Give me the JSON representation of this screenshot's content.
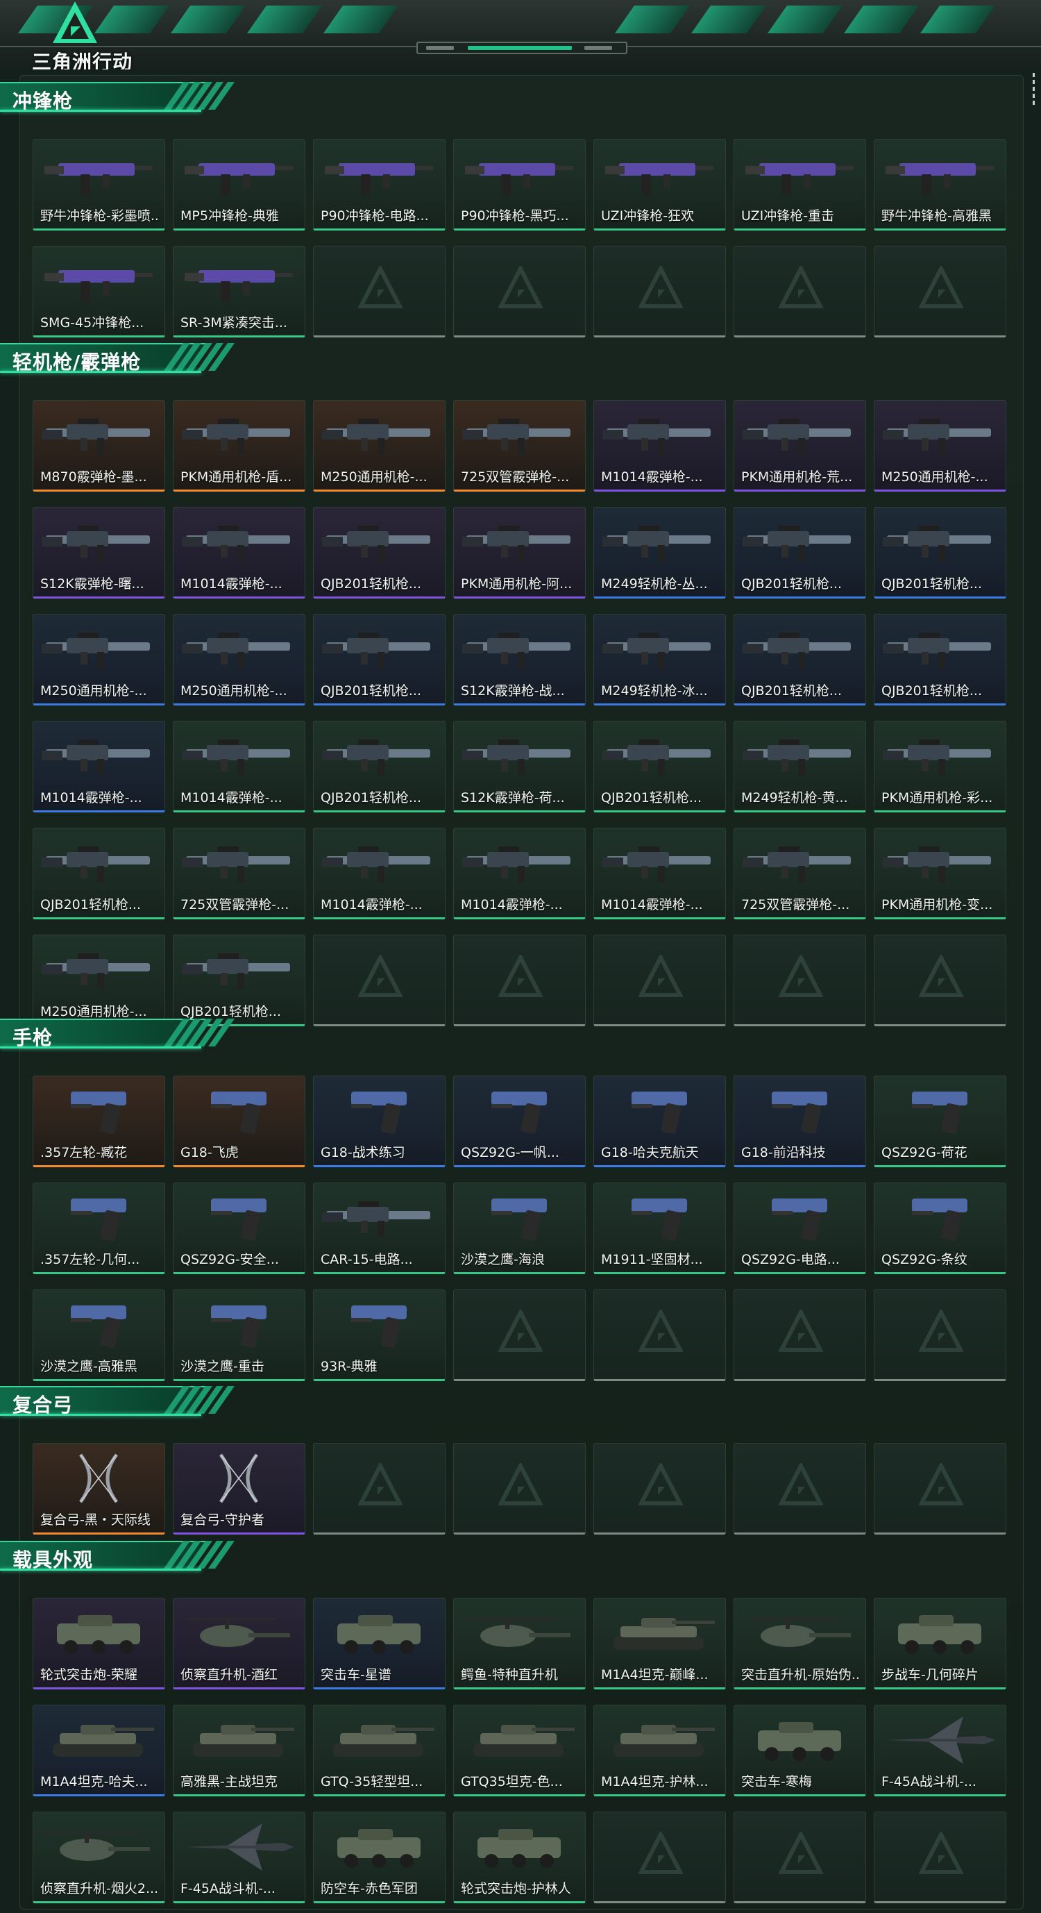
{
  "app": {
    "logo_text": "三角洲行动"
  },
  "colors": {
    "gold": "#f08a2c",
    "purple": "#7f55e0",
    "blue": "#3c7be3",
    "green": "#37c787",
    "empty": "#7d8a86",
    "accent": "#2fe0a0"
  },
  "sections": [
    {
      "title": "冲锋枪",
      "items": [
        {
          "name": "野牛冲锋枪-彩墨喷...",
          "rarity": "green",
          "icon": "smg"
        },
        {
          "name": "MP5冲锋枪-典雅",
          "rarity": "green",
          "icon": "smg"
        },
        {
          "name": "P90冲锋枪-电路...",
          "rarity": "green",
          "icon": "smg"
        },
        {
          "name": "P90冲锋枪-黑巧...",
          "rarity": "green",
          "icon": "smg"
        },
        {
          "name": "UZI冲锋枪-狂欢",
          "rarity": "green",
          "icon": "smg"
        },
        {
          "name": "UZI冲锋枪-重击",
          "rarity": "green",
          "icon": "smg"
        },
        {
          "name": "野牛冲锋枪-高雅黑",
          "rarity": "green",
          "icon": "smg"
        },
        {
          "name": "SMG-45冲锋枪...",
          "rarity": "green",
          "icon": "smg"
        },
        {
          "name": "SR-3M紧凑突击...",
          "rarity": "green",
          "icon": "smg"
        },
        {
          "name": "",
          "rarity": "empty",
          "icon": ""
        },
        {
          "name": "",
          "rarity": "empty",
          "icon": ""
        },
        {
          "name": "",
          "rarity": "empty",
          "icon": ""
        },
        {
          "name": "",
          "rarity": "empty",
          "icon": ""
        },
        {
          "name": "",
          "rarity": "empty",
          "icon": ""
        }
      ]
    },
    {
      "title": "轻机枪/霰弹枪",
      "items": [
        {
          "name": "M870霰弹枪-墨...",
          "rarity": "gold",
          "icon": "rifle"
        },
        {
          "name": "PKM通用机枪-盾...",
          "rarity": "gold",
          "icon": "rifle"
        },
        {
          "name": "M250通用机枪-...",
          "rarity": "gold",
          "icon": "rifle"
        },
        {
          "name": "725双管霰弹枪-...",
          "rarity": "gold",
          "icon": "rifle"
        },
        {
          "name": "M1014霰弹枪-...",
          "rarity": "purple",
          "icon": "rifle"
        },
        {
          "name": "PKM通用机枪-荒...",
          "rarity": "purple",
          "icon": "rifle"
        },
        {
          "name": "M250通用机枪-...",
          "rarity": "purple",
          "icon": "rifle"
        },
        {
          "name": "S12K霰弹枪-曙...",
          "rarity": "purple",
          "icon": "rifle"
        },
        {
          "name": "M1014霰弹枪-...",
          "rarity": "purple",
          "icon": "rifle"
        },
        {
          "name": "QJB201轻机枪...",
          "rarity": "purple",
          "icon": "rifle"
        },
        {
          "name": "PKM通用机枪-阿...",
          "rarity": "purple",
          "icon": "rifle"
        },
        {
          "name": "M249轻机枪-丛...",
          "rarity": "blue",
          "icon": "rifle"
        },
        {
          "name": "QJB201轻机枪...",
          "rarity": "blue",
          "icon": "rifle"
        },
        {
          "name": "QJB201轻机枪...",
          "rarity": "blue",
          "icon": "rifle"
        },
        {
          "name": "M250通用机枪-...",
          "rarity": "blue",
          "icon": "rifle"
        },
        {
          "name": "M250通用机枪-...",
          "rarity": "blue",
          "icon": "rifle"
        },
        {
          "name": "QJB201轻机枪...",
          "rarity": "blue",
          "icon": "rifle"
        },
        {
          "name": "S12K霰弹枪-战...",
          "rarity": "blue",
          "icon": "rifle"
        },
        {
          "name": "M249轻机枪-冰...",
          "rarity": "blue",
          "icon": "rifle"
        },
        {
          "name": "QJB201轻机枪...",
          "rarity": "blue",
          "icon": "rifle"
        },
        {
          "name": "QJB201轻机枪...",
          "rarity": "blue",
          "icon": "rifle"
        },
        {
          "name": "M1014霰弹枪-...",
          "rarity": "blue",
          "icon": "rifle"
        },
        {
          "name": "M1014霰弹枪-...",
          "rarity": "green",
          "icon": "rifle"
        },
        {
          "name": "QJB201轻机枪...",
          "rarity": "green",
          "icon": "rifle"
        },
        {
          "name": "S12K霰弹枪-荷...",
          "rarity": "green",
          "icon": "rifle"
        },
        {
          "name": "QJB201轻机枪...",
          "rarity": "green",
          "icon": "rifle"
        },
        {
          "name": "M249轻机枪-黄...",
          "rarity": "green",
          "icon": "rifle"
        },
        {
          "name": "PKM通用机枪-彩...",
          "rarity": "green",
          "icon": "rifle"
        },
        {
          "name": "QJB201轻机枪...",
          "rarity": "green",
          "icon": "rifle"
        },
        {
          "name": "725双管霰弹枪-...",
          "rarity": "green",
          "icon": "rifle"
        },
        {
          "name": "M1014霰弹枪-...",
          "rarity": "green",
          "icon": "rifle"
        },
        {
          "name": "M1014霰弹枪-...",
          "rarity": "green",
          "icon": "rifle"
        },
        {
          "name": "M1014霰弹枪-...",
          "rarity": "green",
          "icon": "rifle"
        },
        {
          "name": "725双管霰弹枪-...",
          "rarity": "green",
          "icon": "rifle"
        },
        {
          "name": "PKM通用机枪-变...",
          "rarity": "green",
          "icon": "rifle"
        },
        {
          "name": "M250通用机枪-...",
          "rarity": "green",
          "icon": "rifle"
        },
        {
          "name": "QJB201轻机枪...",
          "rarity": "green",
          "icon": "rifle"
        },
        {
          "name": "",
          "rarity": "empty",
          "icon": ""
        },
        {
          "name": "",
          "rarity": "empty",
          "icon": ""
        },
        {
          "name": "",
          "rarity": "empty",
          "icon": ""
        },
        {
          "name": "",
          "rarity": "empty",
          "icon": ""
        },
        {
          "name": "",
          "rarity": "empty",
          "icon": ""
        }
      ]
    },
    {
      "title": "手枪",
      "items": [
        {
          "name": ".357左轮-臧花",
          "rarity": "gold",
          "icon": "pistol"
        },
        {
          "name": "G18-飞虎",
          "rarity": "gold",
          "icon": "pistol"
        },
        {
          "name": "G18-战术练习",
          "rarity": "blue",
          "icon": "pistol"
        },
        {
          "name": "QSZ92G-一帆...",
          "rarity": "blue",
          "icon": "pistol"
        },
        {
          "name": "G18-哈夫克航天",
          "rarity": "blue",
          "icon": "pistol"
        },
        {
          "name": "G18-前沿科技",
          "rarity": "blue",
          "icon": "pistol"
        },
        {
          "name": "QSZ92G-荷花",
          "rarity": "green",
          "icon": "pistol"
        },
        {
          "name": ".357左轮-几何...",
          "rarity": "green",
          "icon": "pistol"
        },
        {
          "name": "QSZ92G-安全...",
          "rarity": "green",
          "icon": "pistol"
        },
        {
          "name": "CAR-15-电路...",
          "rarity": "green",
          "icon": "rifle"
        },
        {
          "name": "沙漠之鹰-海浪",
          "rarity": "green",
          "icon": "pistol"
        },
        {
          "name": "M1911-坚固材...",
          "rarity": "green",
          "icon": "pistol"
        },
        {
          "name": "QSZ92G-电路...",
          "rarity": "green",
          "icon": "pistol"
        },
        {
          "name": "QSZ92G-条纹",
          "rarity": "green",
          "icon": "pistol"
        },
        {
          "name": "沙漠之鹰-高雅黑",
          "rarity": "green",
          "icon": "pistol"
        },
        {
          "name": "沙漠之鹰-重击",
          "rarity": "green",
          "icon": "pistol"
        },
        {
          "name": "93R-典雅",
          "rarity": "green",
          "icon": "pistol"
        },
        {
          "name": "",
          "rarity": "empty",
          "icon": ""
        },
        {
          "name": "",
          "rarity": "empty",
          "icon": ""
        },
        {
          "name": "",
          "rarity": "empty",
          "icon": ""
        },
        {
          "name": "",
          "rarity": "empty",
          "icon": ""
        }
      ]
    },
    {
      "title": "复合弓",
      "items": [
        {
          "name": "复合弓-黑・天际线",
          "rarity": "gold",
          "icon": "bow"
        },
        {
          "name": "复合弓-守护者",
          "rarity": "purple",
          "icon": "bow"
        },
        {
          "name": "",
          "rarity": "empty",
          "icon": ""
        },
        {
          "name": "",
          "rarity": "empty",
          "icon": ""
        },
        {
          "name": "",
          "rarity": "empty",
          "icon": ""
        },
        {
          "name": "",
          "rarity": "empty",
          "icon": ""
        },
        {
          "name": "",
          "rarity": "empty",
          "icon": ""
        }
      ]
    },
    {
      "title": "载具外观",
      "items": [
        {
          "name": "轮式突击炮-荣耀",
          "rarity": "purple",
          "icon": "vehicle"
        },
        {
          "name": "侦察直升机-酒红",
          "rarity": "purple",
          "icon": "heli"
        },
        {
          "name": "突击车-星谱",
          "rarity": "blue",
          "icon": "vehicle"
        },
        {
          "name": "鳄鱼-特种直升机",
          "rarity": "green",
          "icon": "heli"
        },
        {
          "name": "M1A4坦克-巅峰...",
          "rarity": "green",
          "icon": "tank"
        },
        {
          "name": "突击直升机-原始伪...",
          "rarity": "green",
          "icon": "heli"
        },
        {
          "name": "步战车-几何碎片",
          "rarity": "green",
          "icon": "vehicle"
        },
        {
          "name": "M1A4坦克-哈夫...",
          "rarity": "blue",
          "icon": "tank"
        },
        {
          "name": "高雅黑-主战坦克",
          "rarity": "green",
          "icon": "tank"
        },
        {
          "name": "GTQ-35轻型坦...",
          "rarity": "green",
          "icon": "tank"
        },
        {
          "name": "GTQ35坦克-色...",
          "rarity": "green",
          "icon": "tank"
        },
        {
          "name": "M1A4坦克-护林...",
          "rarity": "green",
          "icon": "tank"
        },
        {
          "name": "突击车-寒梅",
          "rarity": "green",
          "icon": "vehicle"
        },
        {
          "name": "F-45A战斗机-...",
          "rarity": "green",
          "icon": "jet"
        },
        {
          "name": "侦察直升机-烟火2...",
          "rarity": "green",
          "icon": "heli"
        },
        {
          "name": "F-45A战斗机-...",
          "rarity": "green",
          "icon": "jet"
        },
        {
          "name": "防空车-赤色军团",
          "rarity": "green",
          "icon": "vehicle"
        },
        {
          "name": "轮式突击炮-护林人",
          "rarity": "green",
          "icon": "vehicle"
        },
        {
          "name": "",
          "rarity": "empty",
          "icon": ""
        },
        {
          "name": "",
          "rarity": "empty",
          "icon": ""
        },
        {
          "name": "",
          "rarity": "empty",
          "icon": ""
        }
      ]
    }
  ]
}
